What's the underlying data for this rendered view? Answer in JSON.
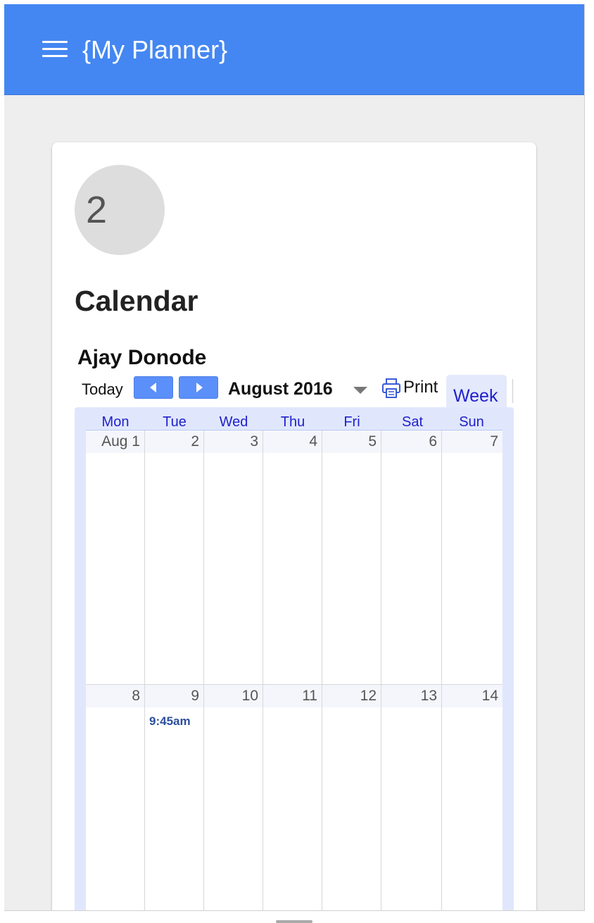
{
  "app": {
    "title": "{My Planner}",
    "menu_icon": "hamburger-menu-icon"
  },
  "card": {
    "step_number": "2",
    "section_title": "Calendar",
    "calendar_owner": "Ajay Donode"
  },
  "toolbar": {
    "today": "Today",
    "prev_icon": "chevron-left-icon",
    "next_icon": "chevron-right-icon",
    "period": "August 2016",
    "dropdown_icon": "caret-down-icon",
    "print": "Print",
    "print_icon": "printer-icon",
    "view_tab": "Week"
  },
  "calendar": {
    "days_of_week": [
      "Mon",
      "Tue",
      "Wed",
      "Thu",
      "Fri",
      "Sat",
      "Sun"
    ],
    "weeks": [
      {
        "dates": [
          "Aug 1",
          "2",
          "3",
          "4",
          "5",
          "6",
          "7"
        ]
      },
      {
        "dates": [
          "8",
          "9",
          "10",
          "11",
          "12",
          "13",
          "14"
        ]
      }
    ],
    "events": [
      {
        "day": "9",
        "time": "9:45am"
      }
    ]
  },
  "colors": {
    "topbar": "#4487f2",
    "background": "#eeeeee",
    "nav_button": "#5b8ff9",
    "link_blue": "#2020cc",
    "event_blue": "#2c4f9e",
    "calendar_frame": "#e0e7fd"
  }
}
